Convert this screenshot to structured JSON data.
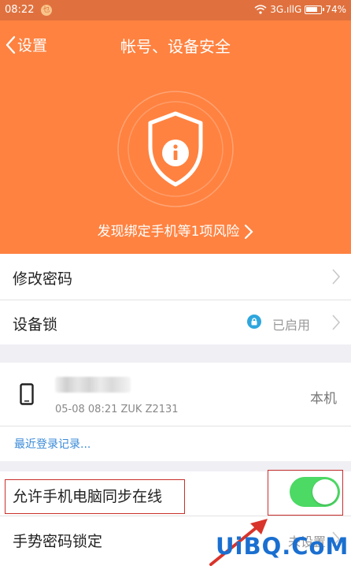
{
  "status_bar": {
    "time": "08:22",
    "app_badge_glyph": "乜",
    "network": "3G.ıllG",
    "battery": "74%"
  },
  "header": {
    "back_label": "设置",
    "title": "帐号、设备安全"
  },
  "risk": {
    "message": "发现绑定手机等1项风险"
  },
  "settings": {
    "change_password": "修改密码",
    "device_lock": "设备锁",
    "device_lock_status": "已启用"
  },
  "device": {
    "meta": "05-08 08:21 ZUK Z2131",
    "tag": "本机",
    "recent_login": "最近登录记录..."
  },
  "sync": {
    "label": "允许手机电脑同步在线",
    "enabled": true
  },
  "gesture": {
    "label": "手势密码锁定",
    "status": "未设置"
  },
  "watermark": "UiBQ.CoM",
  "colors": {
    "hero_orange": "#ff8240",
    "status_orange": "#e0713e",
    "toggle_green": "#4cd964",
    "link_blue": "#3a8ad8",
    "lock_blue": "#2ea6dd",
    "annotation_red": "#c9302c"
  }
}
